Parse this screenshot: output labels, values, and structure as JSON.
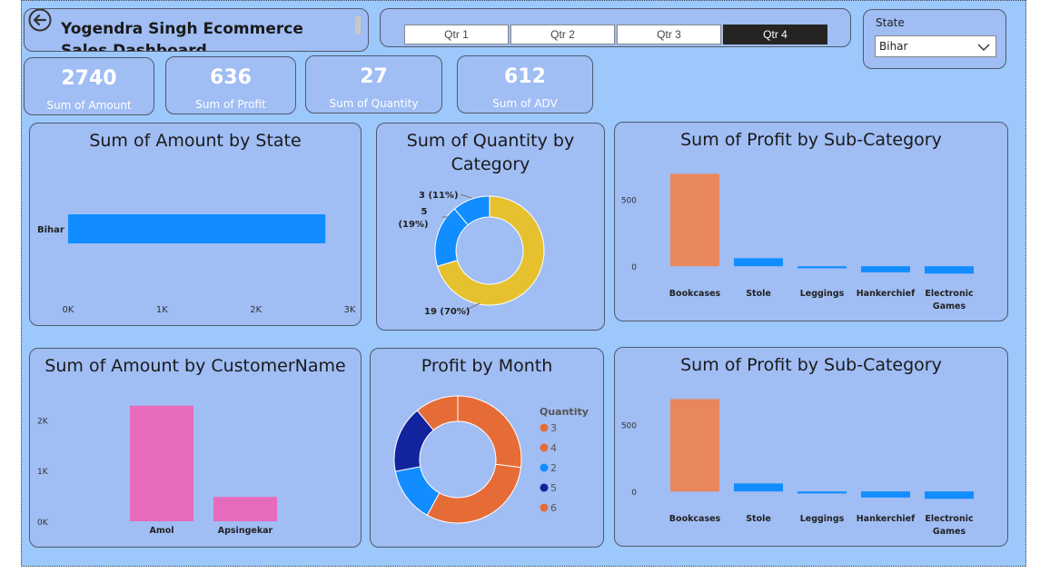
{
  "header": {
    "title": "Yogendra Singh Ecommerce Sales Dashboard"
  },
  "icons": {
    "back": "back-arrow-icon",
    "dropdown": "chevron-down-icon"
  },
  "quarters": [
    "Qtr 1",
    "Qtr 2",
    "Qtr 3",
    "Qtr 4"
  ],
  "quarter_selected": "Qtr 4",
  "state_filter": {
    "label": "State",
    "value": "Bihar"
  },
  "kpis": [
    {
      "value": "2740",
      "label": "Sum of Amount"
    },
    {
      "value": "636",
      "label": "Sum of Profit"
    },
    {
      "value": "27",
      "label": "Sum of Quantity"
    },
    {
      "value": "612",
      "label": "Sum of ADV"
    }
  ],
  "colors": {
    "canvas": "#9cc8fb",
    "panel": "#a0bdf4",
    "blue": "#118dff",
    "orange": "#e8875c",
    "pink": "#e66bbd",
    "yellow": "#e5c130",
    "deep_orange": "#e66c37",
    "navy": "#12239e"
  },
  "chart_data": [
    {
      "type": "bar",
      "orientation": "horizontal",
      "title": "Sum of Amount by State",
      "categories": [
        "Bihar"
      ],
      "values": [
        2740
      ],
      "xlim": [
        0,
        3000
      ],
      "xticks": [
        "0K",
        "1K",
        "2K",
        "3K"
      ]
    },
    {
      "type": "pie",
      "donut": true,
      "title": "Sum of Quantity by Category",
      "values": [
        19,
        5,
        3
      ],
      "labels": [
        "19 (70%)",
        "5 (19%)",
        "3 (11%)"
      ],
      "colors": [
        "#e5c130",
        "#118dff",
        "#118dff"
      ]
    },
    {
      "type": "bar",
      "title": "Sum of Profit by Sub-Category",
      "categories": [
        "Bookcases",
        "Stole",
        "Leggings",
        "Hankerchief",
        "Electronic Games"
      ],
      "values": [
        690,
        60,
        -15,
        -45,
        -55
      ],
      "ylim": [
        -80,
        720
      ],
      "yticks": [
        0,
        500
      ]
    },
    {
      "type": "bar",
      "title": "Sum of Amount by CustomerName",
      "categories": [
        "Amol",
        "Apsingekar"
      ],
      "values": [
        2280,
        480
      ],
      "ylim": [
        0,
        2400
      ],
      "yticks": [
        "0K",
        "1K",
        "2K"
      ]
    },
    {
      "type": "pie",
      "donut": true,
      "title": "Profit by Month",
      "legend_title": "Quantity",
      "legend": [
        "3",
        "4",
        "2",
        "5",
        "6"
      ],
      "legend_colors": [
        "#e66c37",
        "#e66c37",
        "#118dff",
        "#12239e",
        "#e66c37"
      ],
      "values": [
        27,
        31,
        14,
        17,
        11
      ],
      "colors": [
        "#e66c37",
        "#e66c37",
        "#118dff",
        "#12239e",
        "#e66c37"
      ]
    },
    {
      "type": "bar",
      "title": "Sum of Profit by Sub-Category",
      "categories": [
        "Bookcases",
        "Stole",
        "Leggings",
        "Hankerchief",
        "Electronic Games"
      ],
      "values": [
        690,
        60,
        -15,
        -45,
        -55
      ],
      "ylim": [
        -80,
        720
      ],
      "yticks": [
        0,
        500
      ]
    }
  ]
}
